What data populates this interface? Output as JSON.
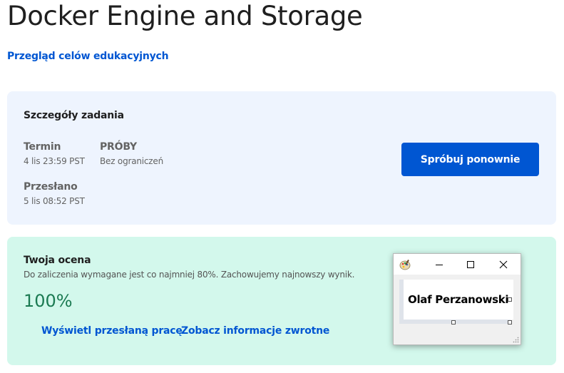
{
  "page": {
    "title": "Docker Engine and Storage",
    "top_link": "Przegląd celów edukacyjnych"
  },
  "details": {
    "heading": "Szczegóły zadania",
    "deadline_label": "Termin",
    "deadline_value": "4 lis 23:59 PST",
    "attempts_label": "PRÓBY",
    "attempts_value": "Bez ograniczeń",
    "submitted_label": "Przesłano",
    "submitted_value": "5 lis 08:52 PST",
    "retry_button": "Spróbuj ponownie"
  },
  "grade": {
    "heading": "Twoja ocena",
    "note": "Do zaliczenia wymagane jest co najmniej 80%. Zachowujemy najnowszy wynik.",
    "value": "100%",
    "view_submission_link": "Wyświetl przesłaną pracę",
    "feedback_link": "Zobacz informacje zwrotne"
  },
  "mini_window": {
    "label": "Olaf Perzanowski",
    "app_icon": "paint-palette-icon",
    "controls": [
      "minimize-icon",
      "maximize-icon",
      "close-icon"
    ]
  },
  "colors": {
    "accent": "#0056d2",
    "details_bg": "#eef4fe",
    "grade_bg": "#d3f8ec",
    "grade_text": "#1b7a52"
  }
}
